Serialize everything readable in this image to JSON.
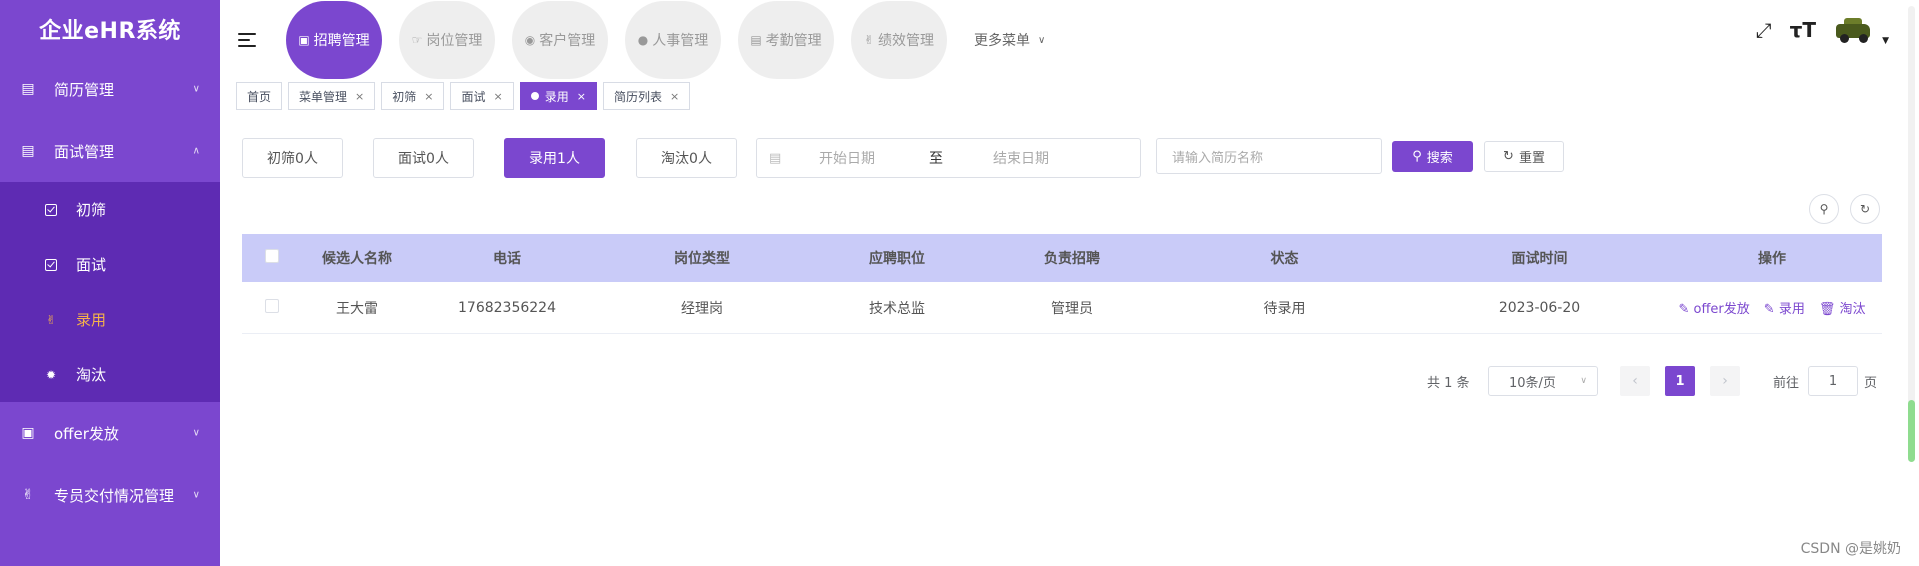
{
  "app": {
    "title": "企业eHR系统"
  },
  "sidebar": {
    "items": [
      {
        "label": "简历管理",
        "icon": "document-icon"
      },
      {
        "label": "面试管理",
        "icon": "document-icon",
        "expanded": true
      },
      {
        "label": "offer发放",
        "icon": "card-icon"
      },
      {
        "label": "专员交付情况管理",
        "icon": "hand-icon"
      }
    ],
    "submenu": [
      {
        "label": "初筛",
        "icon": "checkbox-icon"
      },
      {
        "label": "面试",
        "icon": "checkbox-icon"
      },
      {
        "label": "录用",
        "icon": "hand-icon",
        "active": true
      },
      {
        "label": "淘汰",
        "icon": "bug-icon"
      }
    ],
    "colors": {
      "background": "#7b47cf",
      "submenu": "#5e2bb3",
      "active_text": "#f6b24a"
    }
  },
  "header": {
    "tabs": [
      {
        "label": "招聘管理",
        "active": true
      },
      {
        "label": "岗位管理"
      },
      {
        "label": "客户管理"
      },
      {
        "label": "人事管理"
      },
      {
        "label": "考勤管理"
      },
      {
        "label": "绩效管理"
      }
    ],
    "more_menu": "更多菜单",
    "icons": [
      "fullscreen-icon",
      "font-size-icon"
    ]
  },
  "tags": [
    {
      "label": "首页",
      "closable": false
    },
    {
      "label": "菜单管理",
      "closable": true
    },
    {
      "label": "初筛",
      "closable": true
    },
    {
      "label": "面试",
      "closable": true
    },
    {
      "label": "录用",
      "closable": true,
      "active": true
    },
    {
      "label": "简历列表",
      "closable": true
    }
  ],
  "filters": {
    "status_buttons": [
      {
        "label": "初筛0人"
      },
      {
        "label": "面试0人"
      },
      {
        "label": "录用1人",
        "active": true
      },
      {
        "label": "淘汰0人"
      }
    ],
    "date_start_placeholder": "开始日期",
    "date_separator": "至",
    "date_end_placeholder": "结束日期",
    "search_placeholder": "请输入简历名称",
    "search_label": "搜索",
    "reset_label": "重置"
  },
  "table": {
    "columns": [
      "候选人名称",
      "电话",
      "岗位类型",
      "应聘职位",
      "负责招聘",
      "状态",
      "面试时间",
      "操作"
    ],
    "rows": [
      {
        "name": "王大雷",
        "phone": "17682356224",
        "job_type": "经理岗",
        "position": "技术总监",
        "recruiter": "管理员",
        "status": "待录用",
        "interview_time": "2023-06-20",
        "actions": [
          "offer发放",
          "录用",
          "淘汰"
        ]
      }
    ]
  },
  "pagination": {
    "total_text": "共 1 条",
    "page_size": "10条/页",
    "current_page": "1",
    "goto_prefix": "前往",
    "goto_value": "1",
    "goto_suffix": "页"
  },
  "watermark": "CSDN @是姚奶"
}
